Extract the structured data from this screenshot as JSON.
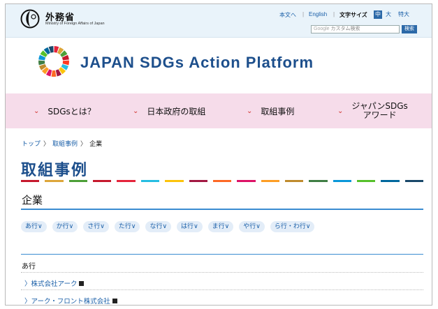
{
  "header": {
    "org_name": "外務省",
    "org_sub": "Ministry of Foreign Affairs of Japan",
    "util": {
      "main_text": "本文へ",
      "english": "English",
      "text_size_label": "文字サイズ",
      "size_medium": "中",
      "size_large": "大",
      "size_xlarge": "特大",
      "separator": "|"
    },
    "search": {
      "google_label": "Google",
      "placeholder": "カスタム検索",
      "button": "検索"
    }
  },
  "banner": {
    "title": "JAPAN SDGs Action Platform",
    "wheel_colors": [
      "#e5243b",
      "#dda63a",
      "#4c9f38",
      "#c5192d",
      "#ff3a21",
      "#26bde2",
      "#fcc30b",
      "#a21942",
      "#fd6925",
      "#dd1367",
      "#fd9d24",
      "#bf8b2e",
      "#3f7e44",
      "#0a97d9",
      "#56c02b",
      "#00689d",
      "#19486a"
    ]
  },
  "nav": [
    {
      "label": "SDGsとは？"
    },
    {
      "label": "日本政府の取組"
    },
    {
      "label": "取組事例"
    },
    {
      "label_line1": "ジャパンSDGs",
      "label_line2": "アワード"
    }
  ],
  "breadcrumb": {
    "items": [
      "トップ",
      "取組事例"
    ],
    "current": "企業",
    "arrow": "〉"
  },
  "page": {
    "title": "取組事例",
    "title_bar_colors": [
      "#c5192d",
      "#dda63a",
      "#4c9f38",
      "#c5192d",
      "#e5243b",
      "#26bde2",
      "#fcc30b",
      "#a21942",
      "#fd6925",
      "#dd1367",
      "#fd9d24",
      "#bf8b2e",
      "#3f7e44",
      "#0a97d9",
      "#56c02b",
      "#00689d",
      "#19486a"
    ],
    "section": "企業",
    "kana_filters": [
      "あ行",
      "か行",
      "さ行",
      "た行",
      "な行",
      "は行",
      "ま行",
      "や行",
      "ら行・わ行"
    ],
    "kana_chevron": "∨",
    "group": "あ行",
    "companies": [
      "株式会社アーク",
      "アーク・フロント株式会社"
    ],
    "company_arrow": "〉"
  }
}
